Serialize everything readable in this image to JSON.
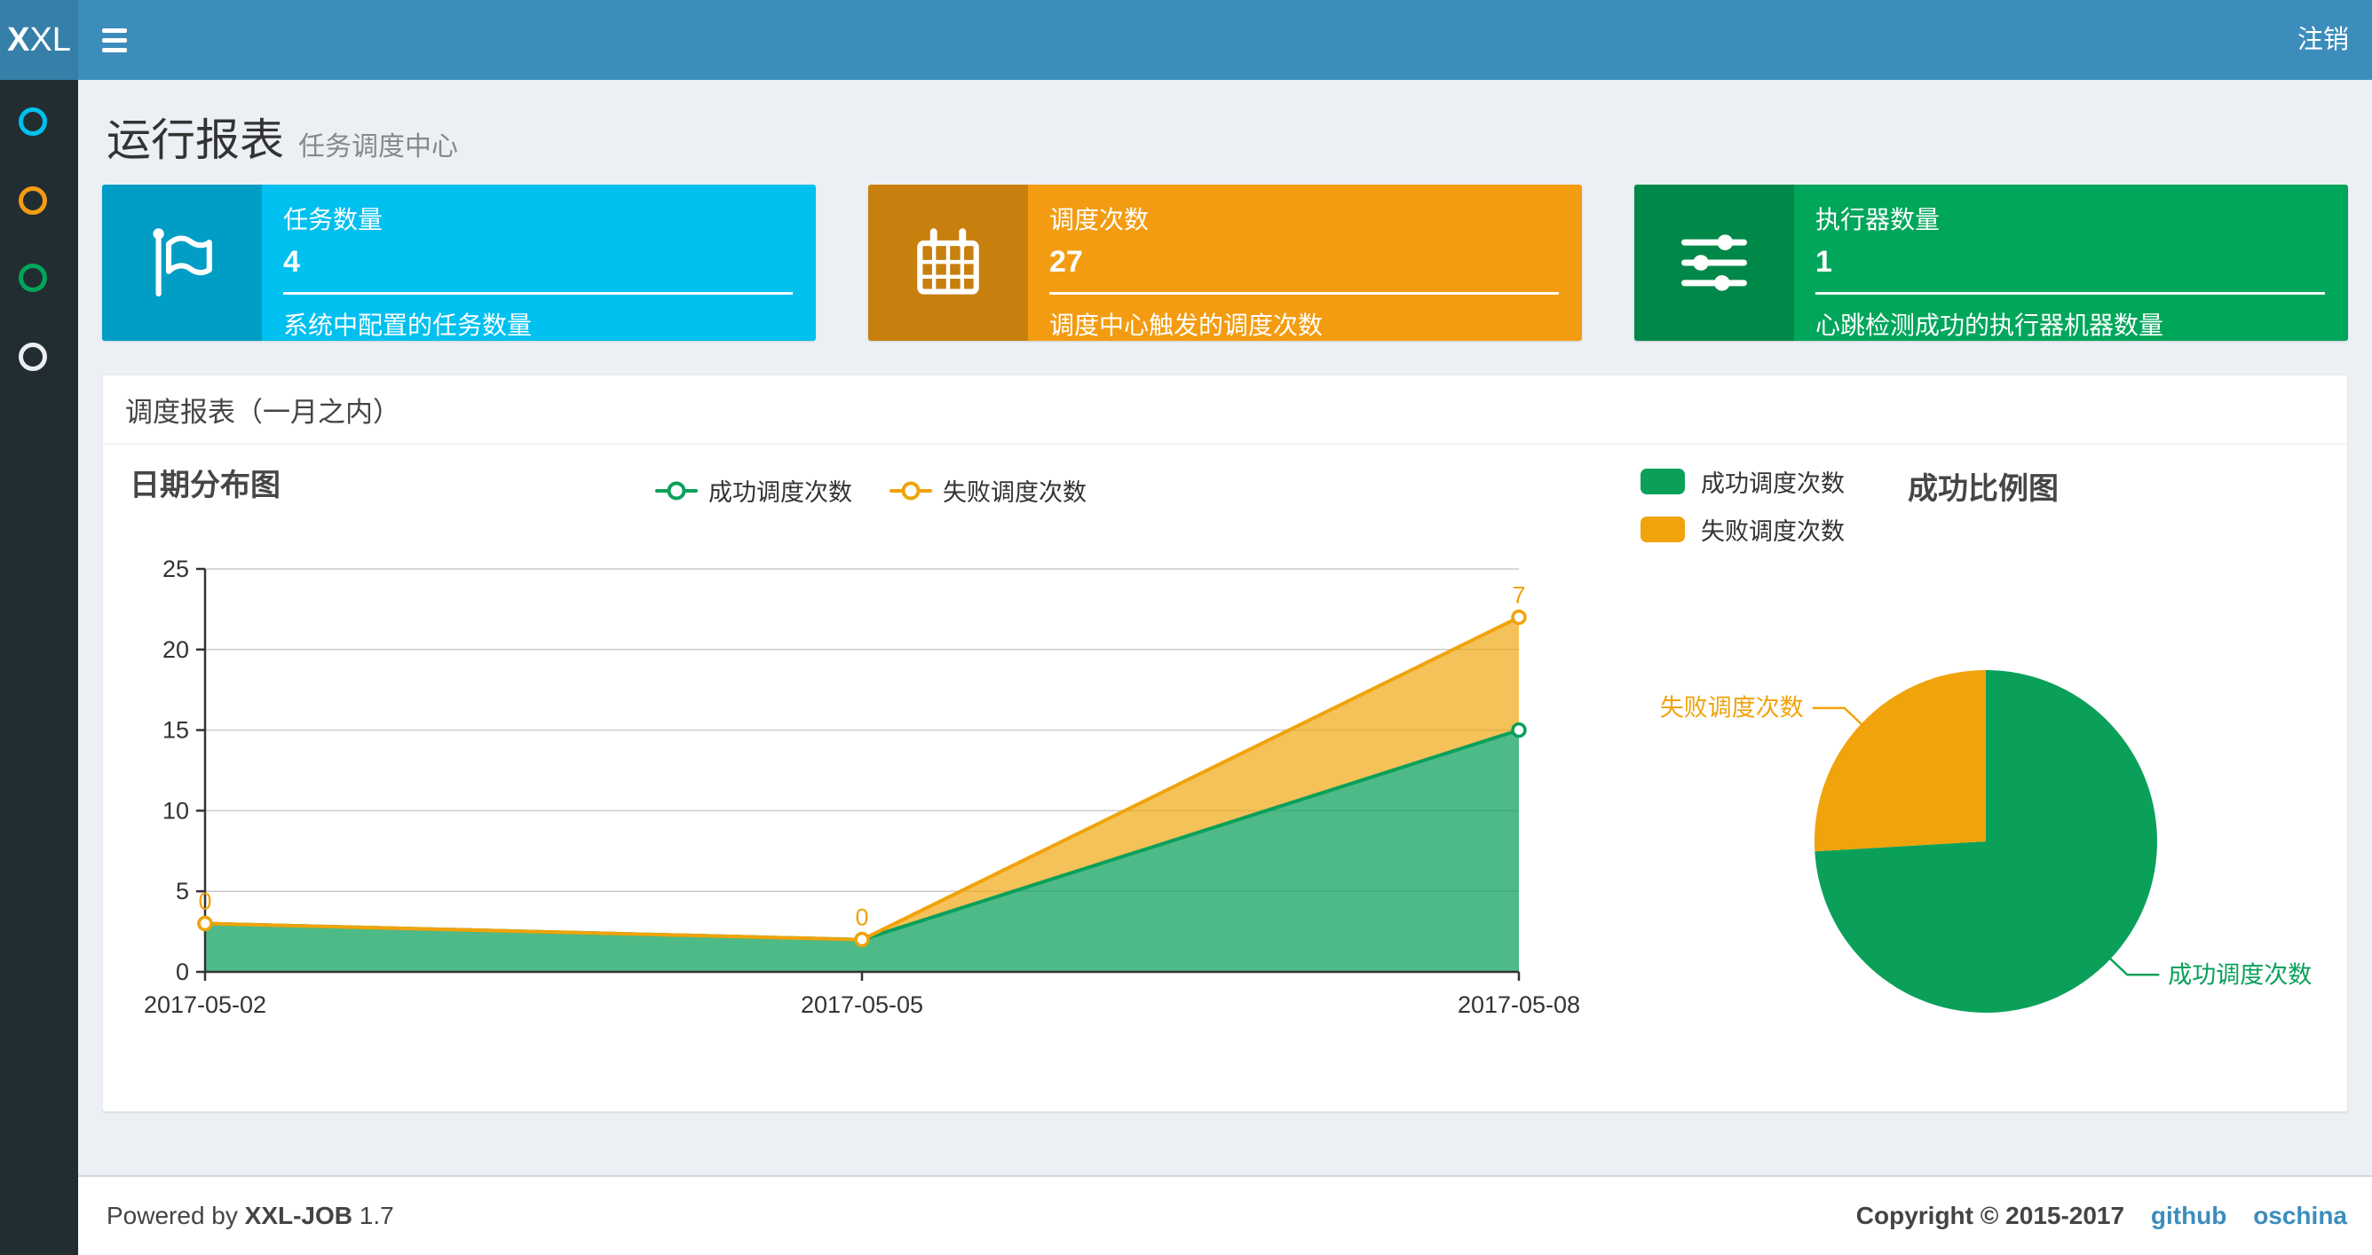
{
  "navbar": {
    "logo_bold": "X",
    "logo_rest": "XL",
    "logout_label": "注销"
  },
  "sidebar": {
    "items": [
      {
        "name": "menu-report",
        "color": "#00c0ef"
      },
      {
        "name": "menu-jobs",
        "color": "#f39c12"
      },
      {
        "name": "menu-logs",
        "color": "#00a65a"
      },
      {
        "name": "menu-help",
        "color": "#eceef1"
      }
    ]
  },
  "page": {
    "title": "运行报表",
    "subtitle": "任务调度中心"
  },
  "info_boxes": [
    {
      "title": "任务数量",
      "value": "4",
      "description": "系统中配置的任务数量",
      "color": "#00c0ef",
      "icon": "flag-icon"
    },
    {
      "title": "调度次数",
      "value": "27",
      "description": "调度中心触发的调度次数",
      "color": "#f39c12",
      "icon": "calendar-icon"
    },
    {
      "title": "执行器数量",
      "value": "1",
      "description": "心跳检测成功的执行器机器数量",
      "color": "#00a65a",
      "icon": "sliders-icon"
    }
  ],
  "panel": {
    "title": "调度报表（一月之内）"
  },
  "chart_data": [
    {
      "type": "area",
      "title": "日期分布图",
      "stacked": true,
      "x": [
        "2017-05-02",
        "2017-05-05",
        "2017-05-08"
      ],
      "series": [
        {
          "name": "成功调度次数",
          "color": "#0aa05a",
          "values": [
            3,
            2,
            15
          ],
          "show_point_labels": false
        },
        {
          "name": "失败调度次数",
          "color": "#f0a30a",
          "values": [
            0,
            0,
            7
          ],
          "show_point_labels": true
        }
      ],
      "ylim": [
        0,
        25
      ],
      "yticks": [
        0,
        5,
        10,
        15,
        20,
        25
      ],
      "grid": true,
      "legend_position": "top"
    },
    {
      "type": "pie",
      "title": "成功比例图",
      "slices": [
        {
          "label": "成功调度次数",
          "value": 20,
          "color": "#0aa05a"
        },
        {
          "label": "失败调度次数",
          "value": 7,
          "color": "#f0a30a"
        }
      ],
      "start_angle": 90,
      "direction": "clockwise",
      "legend_position": "top-left"
    }
  ],
  "footer": {
    "powered_prefix": "Powered by",
    "brand": "XXL-JOB",
    "version": "1.7",
    "copyright": "Copyright © 2015-2017",
    "links": [
      "github",
      "oschina"
    ]
  }
}
